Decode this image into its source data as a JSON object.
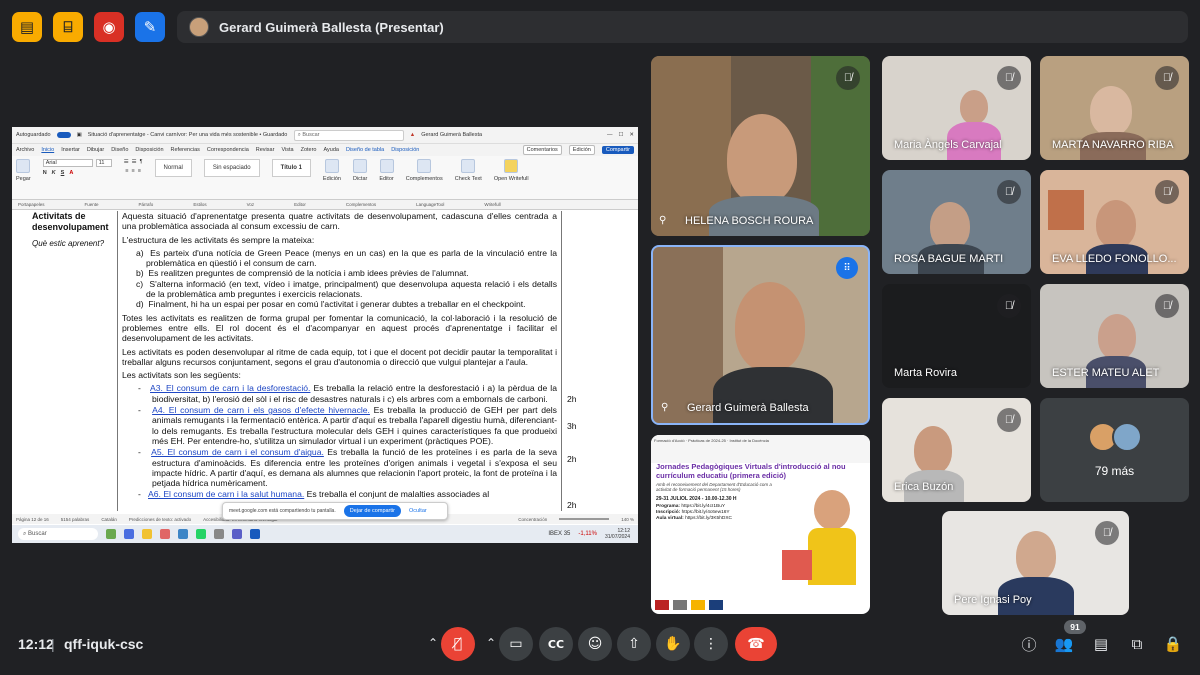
{
  "top_icons": [
    {
      "icon": "captions-off-icon",
      "color": "#f9ab00",
      "fg": "#202124"
    },
    {
      "icon": "door-icon",
      "color": "#f9ab00",
      "fg": "#202124"
    },
    {
      "icon": "record-icon",
      "color": "#d93025",
      "fg": "#ffffff"
    },
    {
      "icon": "whiteboard-icon",
      "color": "#1a73e8",
      "fg": "#ffffff"
    }
  ],
  "presenter": {
    "label": "Gerard Guimerà Ballesta (Presentar)"
  },
  "word": {
    "autosave": "Autoguardado",
    "title": "Situació d'aprenentatge - Canvi carnívor: Per una vida més sostenible • Guardado",
    "search": "Buscar",
    "user": "Gerard Guimerà Ballesta",
    "menu": [
      "Archivo",
      "Inicio",
      "Insertar",
      "Dibujar",
      "Diseño",
      "Disposición",
      "Referencias",
      "Correspondencia",
      "Revisar",
      "Vista",
      "Zotero",
      "Ayuda",
      "Diseño de tabla",
      "Disposición"
    ],
    "menu_right": [
      "Comentarios",
      "Edición",
      "Compartir"
    ],
    "ribbon": [
      "Pegar",
      "Normal",
      "Sin espaciado",
      "Título 1",
      "Edición",
      "Dictar",
      "Editor",
      "Complementos",
      "Check Text",
      "Open Writefull"
    ],
    "font": "Arial",
    "font_size": "11",
    "ribbon_groups": [
      "Portapapeles",
      "Fuente",
      "Párrafo",
      "Estilos",
      "Voz",
      "Editor",
      "Complementos",
      "LanguageTool",
      "Writefull"
    ],
    "doc": {
      "left_title": "Activitats de desenvolupament",
      "left_question": "Què estic aprenent?",
      "p1": "Aquesta situació d'aprenentatge presenta quatre activitats de desenvolupament, cadascuna d'elles centrada a una problemàtica associada al consum excessiu de carn.",
      "p2": "L'estructura de les activitats és sempre la mateixa:",
      "items": [
        "a)  Es parteix d'una notícia de Green Peace (menys en un cas) en la que es parla de la vinculació entre la problemàtica en qüestió i el consum de carn.",
        "b)  Es realitzen preguntes de comprensió de la notícia i amb idees prèvies de l'alumnat.",
        "c)  S'alterna informació (en text, vídeo i imatge, principalment) que desenvolupa aquesta relació i els detalls de la problemàtica amb preguntes i exercicis relacionats.",
        "d)  Finalment, hi ha un espai per posar en comú l'activitat i generar dubtes a treballar en el checkpoint."
      ],
      "p3": "Totes les activitats es realitzen de forma grupal per fomentar la comunicació, la col·laboració i la resolució de problemes entre ells. El rol docent és el d'acompanyar en aquest procés d'aprenentatge i facilitar el desenvolupament de les activitats.",
      "p4": "Les activitats es poden desenvolupar al ritme de cada equip, tot i que el docent pot decidir pautar la temporalitat i treballar alguns recursos conjuntament, segons el grau d'autonomia o direcció que vulgui plantejar a l'aula.",
      "p5": "Les activitats son les següents:",
      "activities": [
        {
          "link": "A3. El consum de carn i la desforestació.",
          "text": " Es treballa la relació entre la desforestació i a) la pèrdua de la biodiversitat, b) l'erosió del sòl i el risc de desastres naturals i c) els arbres com a embornals de carboni.",
          "hours": "2h"
        },
        {
          "link": "A4. El consum de carn i els gasos d'efecte hivernacle.",
          "text": " Es treballa la producció de GEH per part dels animals remugants i la fermentació entèrica. A partir d'aquí es treballa l'aparell digestiu humà, diferenciant-lo dels remugants. Es treballa l'estructura molecular dels GEH i quines característiques fa que produeixi més EH. Per entendre-ho, s'utilitza un simulador virtual i un experiment (pràctiques POE).",
          "hours": "3h"
        },
        {
          "link": "A5. El consum de carn i el consum d'aigua.",
          "text": " Es treballa la funció de les proteïnes i es parla de la seva estructura d'aminoàcids. Es diferencia entre les proteïnes d'origen animals i vegetal i s'exposa el seu impacte hídric. A partir d'aquí, es demana als alumnes que relacionin l'aport proteic, la font de proteïna i la petjada hídrica numèricament.",
          "hours": "2h"
        },
        {
          "link": "A6. El consum de carn i la salut humana.",
          "text": " Es treballa el conjunt de malalties associades al",
          "hours": "2h"
        }
      ],
      "status": [
        "Página 12 de 16",
        "5154 palabras",
        "Catalán",
        "Predicciones de texto: activado",
        "Accesibilidad: es necesario investigar",
        "Concentración",
        "140 %"
      ]
    },
    "share_notice": "meet.google.com está compartiendo tu pantalla.",
    "stop_share": "Dejar de compartir",
    "hide": "Ocultar",
    "taskbar_search": "Buscar",
    "ticker": "IBEX 35",
    "ticker_value": "-1,11%",
    "task_time": "12:12",
    "task_date": "31/07/2024"
  },
  "participants": [
    {
      "name": "HELENA BOSCH ROURA",
      "muted": true,
      "pinned": true
    },
    {
      "name": "Gerard Guimerà Ballesta",
      "muted": false,
      "pinned": true
    },
    {
      "name": "Maria Àngels Carvajal",
      "muted": true
    },
    {
      "name": "MARTA NAVARRO RIBA",
      "muted": true
    },
    {
      "name": "ROSA BAGUE MARTI",
      "muted": true
    },
    {
      "name": "EVA LLEDO FONOLLO...",
      "muted": true
    },
    {
      "name": "Marta Rovira",
      "muted": true
    },
    {
      "name": "ESTER MATEU ALET",
      "muted": true
    },
    {
      "name": "Erica Buzón",
      "muted": true
    },
    {
      "name": "Pere Ignasi Poy",
      "muted": true
    }
  ],
  "more": "79 más",
  "poster": {
    "top": "Formació d'Acció · Prácticas de 2024-25 · Institut de la Docència",
    "title": "Jornades Pedagògiques Virtuals d'introducció al nou currículum educatiu (primera edició)",
    "subtitle": "Amb el reconeixement del Departament d'Educació com a activitat de formació permanent (15 hores)",
    "date": "29-31 JULIOL 2024 - 10.00-12.30 H",
    "program_label": "Programa:",
    "program_url": "https://bit.ly/4cI1BuY",
    "signup_label": "Inscripció:",
    "signup_url": "https://bit.ly/4c6ew16Y",
    "room_label": "Aula virtual:",
    "room_url": "https://bit.ly/3K5hDXC"
  },
  "bottom": {
    "time": "12:12",
    "separator": "|",
    "code": "qff-iquk-csc",
    "participants_count": "91"
  }
}
